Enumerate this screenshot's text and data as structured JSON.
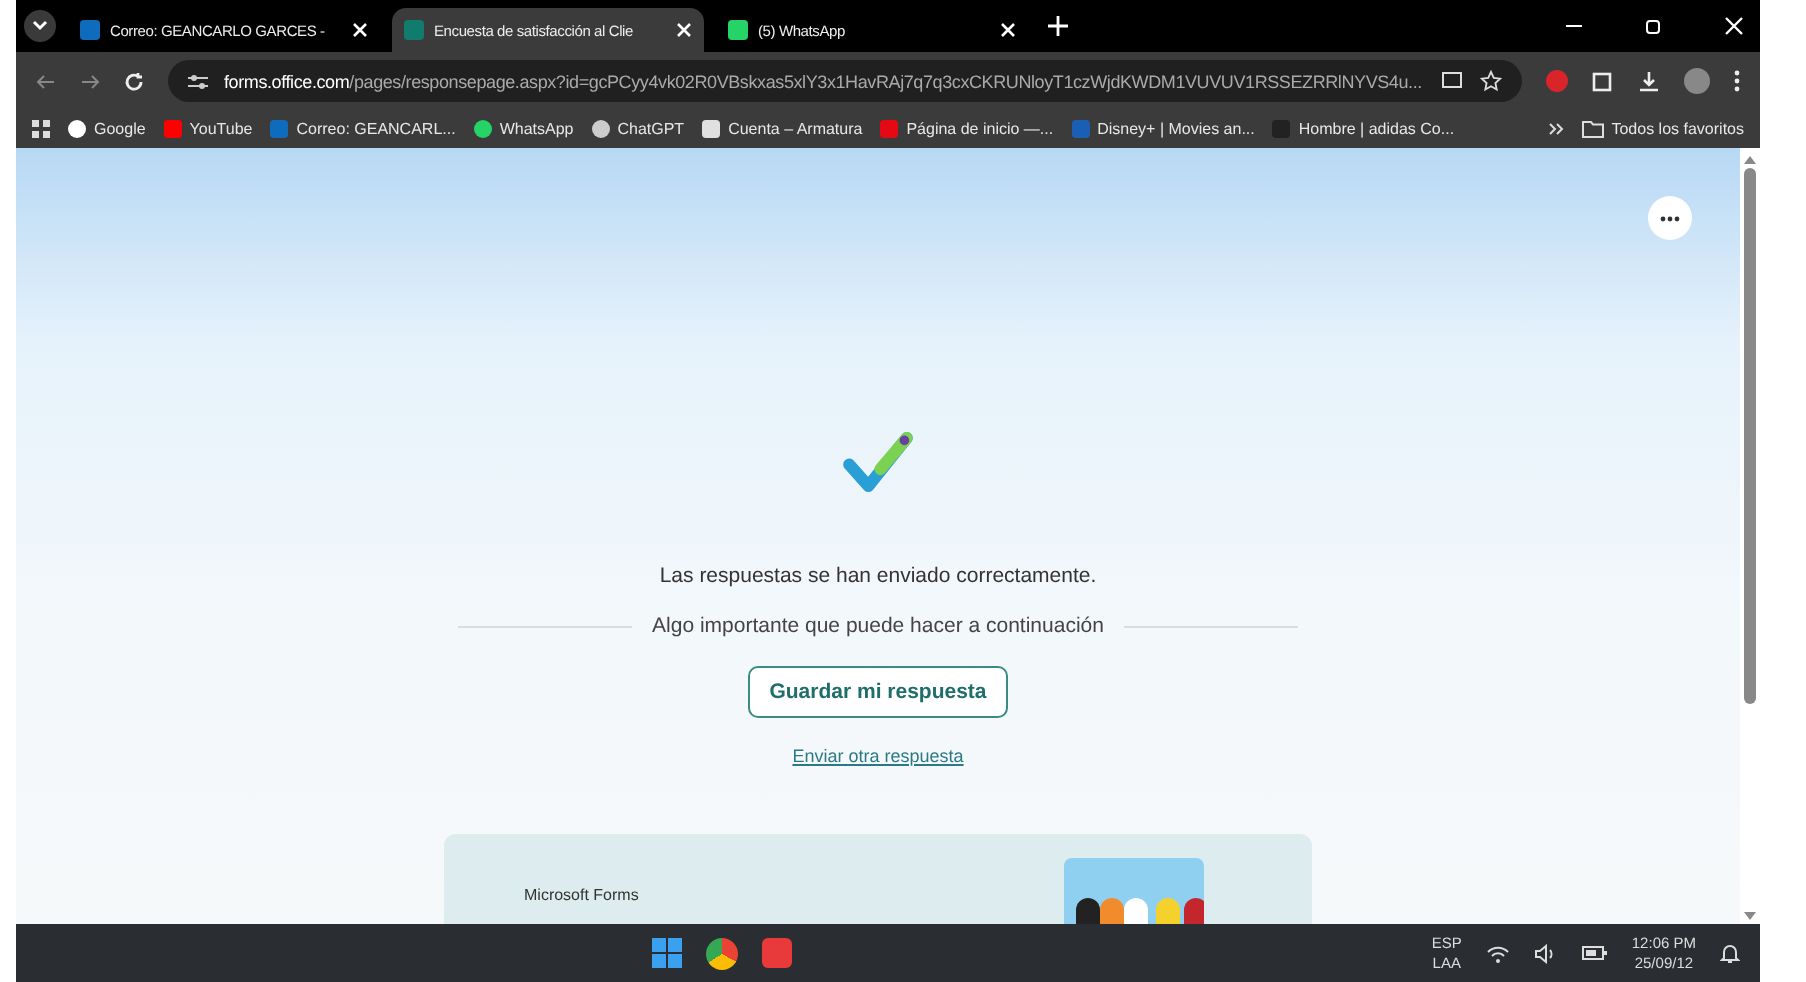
{
  "tabs": [
    {
      "title": "Correo: GEANCARLO GARCES -",
      "kind": "mail",
      "selected": false
    },
    {
      "title": "Encuesta de satisfacción al Clie",
      "kind": "forms",
      "selected": true
    },
    {
      "title": "(5) WhatsApp",
      "kind": "chat",
      "selected": false
    }
  ],
  "address": {
    "host": "forms.office.com",
    "path": "/pages/responsepage.aspx?id=gcPCyy4vk02R0VBskxas5xlY3x1HavRAj7q7q3cxCKRUNloyT1czWjdKWDM1VUVUV1RSSEZRRlNYVS4u..."
  },
  "bookmarks": [
    {
      "label": "Google",
      "kind": "google"
    },
    {
      "label": "YouTube",
      "kind": "video"
    },
    {
      "label": "Correo: GEANCARL...",
      "kind": "mail"
    },
    {
      "label": "WhatsApp",
      "kind": "chat"
    },
    {
      "label": "ChatGPT",
      "kind": "knot"
    },
    {
      "label": "Cuenta – Armatura",
      "kind": "page"
    },
    {
      "label": "Página de inicio —...",
      "kind": "redmark"
    },
    {
      "label": "Disney+ | Movies an...",
      "kind": "arc"
    },
    {
      "label": "Hombre | adidas Co...",
      "kind": "stripes"
    }
  ],
  "all_bookmarks": "Todos los favoritos",
  "content": {
    "message": "Las respuestas se han enviado correctamente.",
    "subtitle": "Algo importante que puede hacer a continuación",
    "save_button": "Guardar mi respuesta",
    "link": "Enviar otra respuesta",
    "card_label": "Microsoft Forms"
  },
  "taskbar": {
    "lang": "ESP",
    "layout": "LAA",
    "time": "12:06 PM",
    "date": "25/09/12"
  }
}
